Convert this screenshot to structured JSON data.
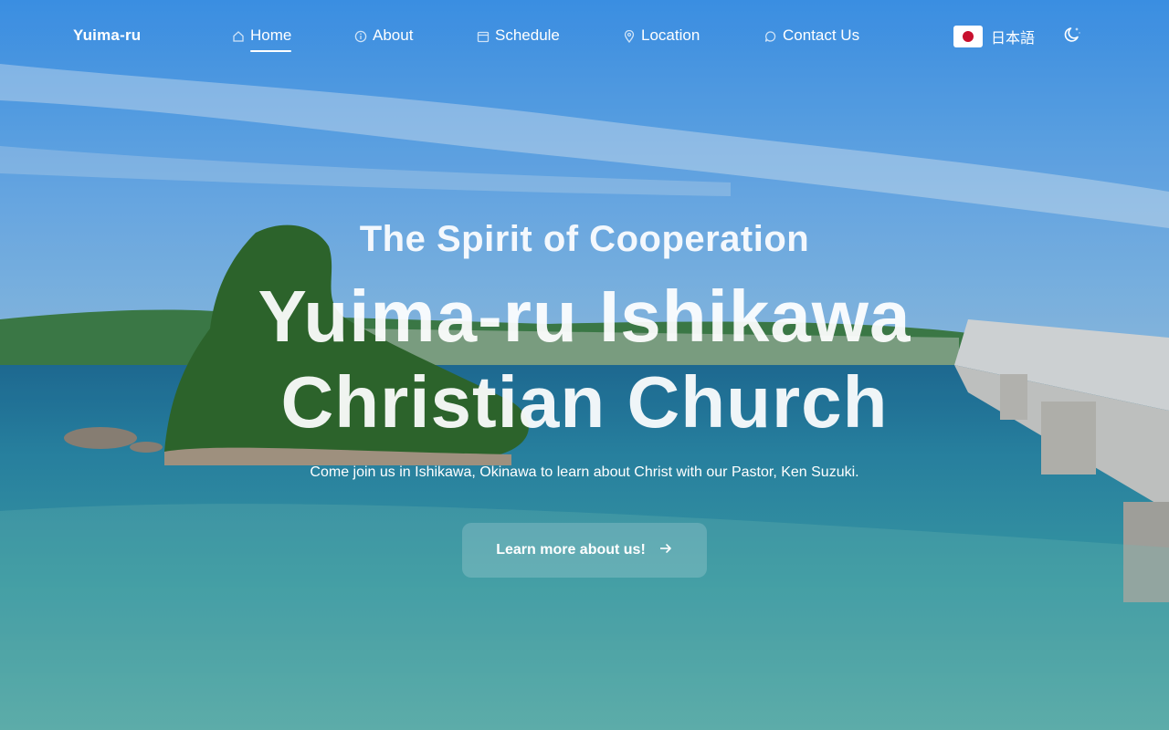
{
  "nav": {
    "brand": "Yuima-ru",
    "items": [
      {
        "label": "Home",
        "icon": "home-icon",
        "active": true
      },
      {
        "label": "About",
        "icon": "info-icon",
        "active": false
      },
      {
        "label": "Schedule",
        "icon": "calendar-icon",
        "active": false
      },
      {
        "label": "Location",
        "icon": "map-pin-icon",
        "active": false
      },
      {
        "label": "Contact Us",
        "icon": "chat-bubble-icon",
        "active": false
      }
    ],
    "language_label": "日本語",
    "language_flag": "japan-flag-icon",
    "theme_icon": "moon-stars-icon"
  },
  "hero": {
    "tagline": "The Spirit of Cooperation",
    "headline_line1": "Yuima-ru Ishikawa",
    "headline_line2": "Christian Church",
    "subtext": "Come join us in Ishikawa, Okinawa to learn about Christ with our Pastor, Ken Suzuki.",
    "cta_label": "Learn more about us!",
    "cta_icon": "arrow-right-icon"
  },
  "colors": {
    "text": "#ffffff",
    "flag_red": "#c8102e",
    "sky": "#3f9bf2",
    "sea": "#2d8fa6"
  }
}
